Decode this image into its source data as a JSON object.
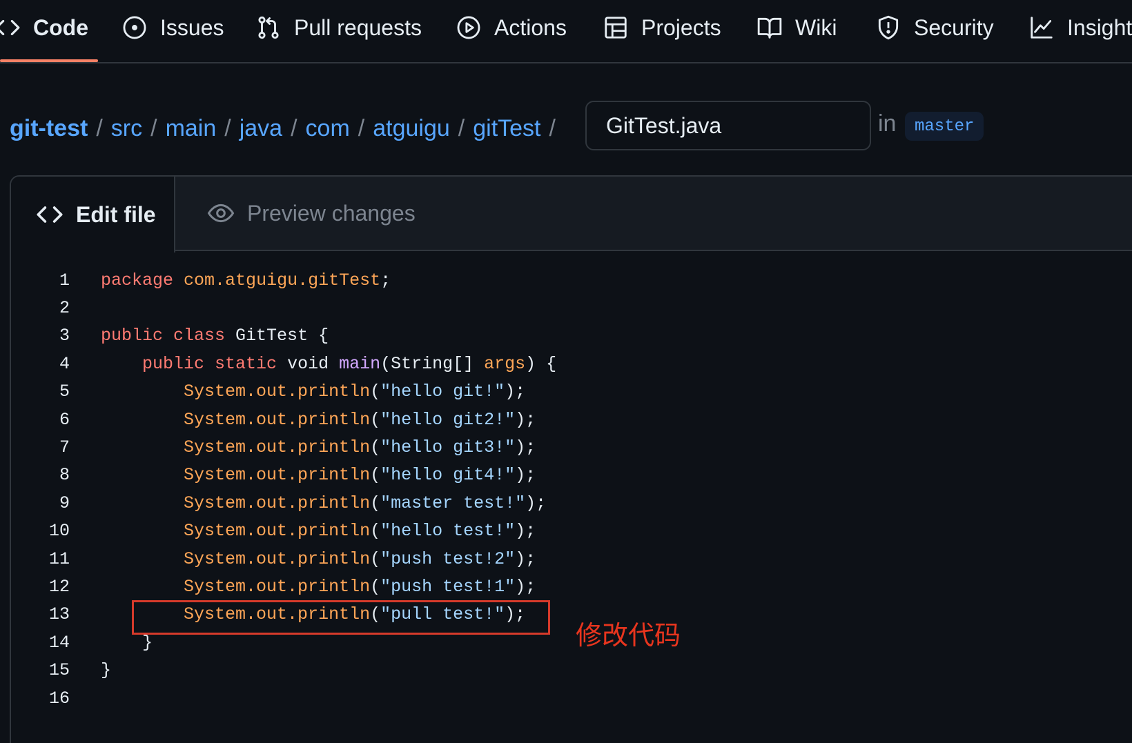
{
  "nav": {
    "tabs": [
      {
        "label": "Code",
        "icon": "code-icon",
        "active": true
      },
      {
        "label": "Issues",
        "icon": "issue-circle-icon"
      },
      {
        "label": "Pull requests",
        "icon": "pull-request-icon"
      },
      {
        "label": "Actions",
        "icon": "play-circle-icon"
      },
      {
        "label": "Projects",
        "icon": "table-icon"
      },
      {
        "label": "Wiki",
        "icon": "book-icon"
      },
      {
        "label": "Security",
        "icon": "shield-icon"
      },
      {
        "label": "Insights",
        "icon": "graph-icon"
      }
    ]
  },
  "breadcrumb": {
    "repo": "git-test",
    "parts": [
      "src",
      "main",
      "java",
      "com",
      "atguigu",
      "gitTest"
    ],
    "separator": "/"
  },
  "file": {
    "name": "GitTest.java",
    "in_label": "in",
    "branch": "master"
  },
  "editor": {
    "tab_edit": "Edit file",
    "tab_preview": "Preview changes",
    "lines": [
      {
        "n": "1",
        "tokens": [
          [
            "kw",
            "package"
          ],
          [
            "",
            " "
          ],
          [
            "pkg",
            "com.atguigu.gitTest"
          ],
          [
            "",
            ";"
          ]
        ]
      },
      {
        "n": "2",
        "tokens": []
      },
      {
        "n": "3",
        "tokens": [
          [
            "kw",
            "public"
          ],
          [
            "",
            " "
          ],
          [
            "kw",
            "class"
          ],
          [
            "",
            " GitTest {"
          ]
        ]
      },
      {
        "n": "4",
        "tokens": [
          [
            "",
            "    "
          ],
          [
            "kw",
            "public"
          ],
          [
            "",
            " "
          ],
          [
            "kw",
            "static"
          ],
          [
            "",
            " void "
          ],
          [
            "fn",
            "main"
          ],
          [
            "",
            "(String[] "
          ],
          [
            "pkg",
            "args"
          ],
          [
            "",
            ") {"
          ]
        ]
      },
      {
        "n": "5",
        "tokens": [
          [
            "",
            "        "
          ],
          [
            "sys",
            "System.out.println"
          ],
          [
            "",
            "("
          ],
          [
            "str",
            "\"hello git!\""
          ],
          [
            "",
            ");"
          ]
        ]
      },
      {
        "n": "6",
        "tokens": [
          [
            "",
            "        "
          ],
          [
            "sys",
            "System.out.println"
          ],
          [
            "",
            "("
          ],
          [
            "str",
            "\"hello git2!\""
          ],
          [
            "",
            ");"
          ]
        ]
      },
      {
        "n": "7",
        "tokens": [
          [
            "",
            "        "
          ],
          [
            "sys",
            "System.out.println"
          ],
          [
            "",
            "("
          ],
          [
            "str",
            "\"hello git3!\""
          ],
          [
            "",
            ");"
          ]
        ]
      },
      {
        "n": "8",
        "tokens": [
          [
            "",
            "        "
          ],
          [
            "sys",
            "System.out.println"
          ],
          [
            "",
            "("
          ],
          [
            "str",
            "\"hello git4!\""
          ],
          [
            "",
            ");"
          ]
        ]
      },
      {
        "n": "9",
        "tokens": [
          [
            "",
            "        "
          ],
          [
            "sys",
            "System.out.println"
          ],
          [
            "",
            "("
          ],
          [
            "str",
            "\"master test!\""
          ],
          [
            "",
            ");"
          ]
        ]
      },
      {
        "n": "10",
        "tokens": [
          [
            "",
            "        "
          ],
          [
            "sys",
            "System.out.println"
          ],
          [
            "",
            "("
          ],
          [
            "str",
            "\"hello test!\""
          ],
          [
            "",
            ");"
          ]
        ]
      },
      {
        "n": "11",
        "tokens": [
          [
            "",
            "        "
          ],
          [
            "sys",
            "System.out.println"
          ],
          [
            "",
            "("
          ],
          [
            "str",
            "\"push test!2\""
          ],
          [
            "",
            ");"
          ]
        ]
      },
      {
        "n": "12",
        "tokens": [
          [
            "",
            "        "
          ],
          [
            "sys",
            "System.out.println"
          ],
          [
            "",
            "("
          ],
          [
            "str",
            "\"push test!1\""
          ],
          [
            "",
            ");"
          ]
        ]
      },
      {
        "n": "13",
        "tokens": [
          [
            "",
            "        "
          ],
          [
            "sys",
            "System.out.println"
          ],
          [
            "",
            "("
          ],
          [
            "str",
            "\"pull test!\""
          ],
          [
            "",
            ");"
          ]
        ]
      },
      {
        "n": "14",
        "tokens": [
          [
            "",
            "    }"
          ]
        ]
      },
      {
        "n": "15",
        "tokens": [
          [
            "",
            "}"
          ]
        ]
      },
      {
        "n": "16",
        "tokens": []
      }
    ]
  },
  "annotation": {
    "text": "修改代码",
    "color": "#e8351e"
  },
  "colors": {
    "background": "#0d1117",
    "link": "#58a6ff",
    "active_underline": "#f78166",
    "keyword": "#ff7b72",
    "string": "#a5d6ff",
    "entity": "#ffa657",
    "function": "#d2a8ff"
  }
}
